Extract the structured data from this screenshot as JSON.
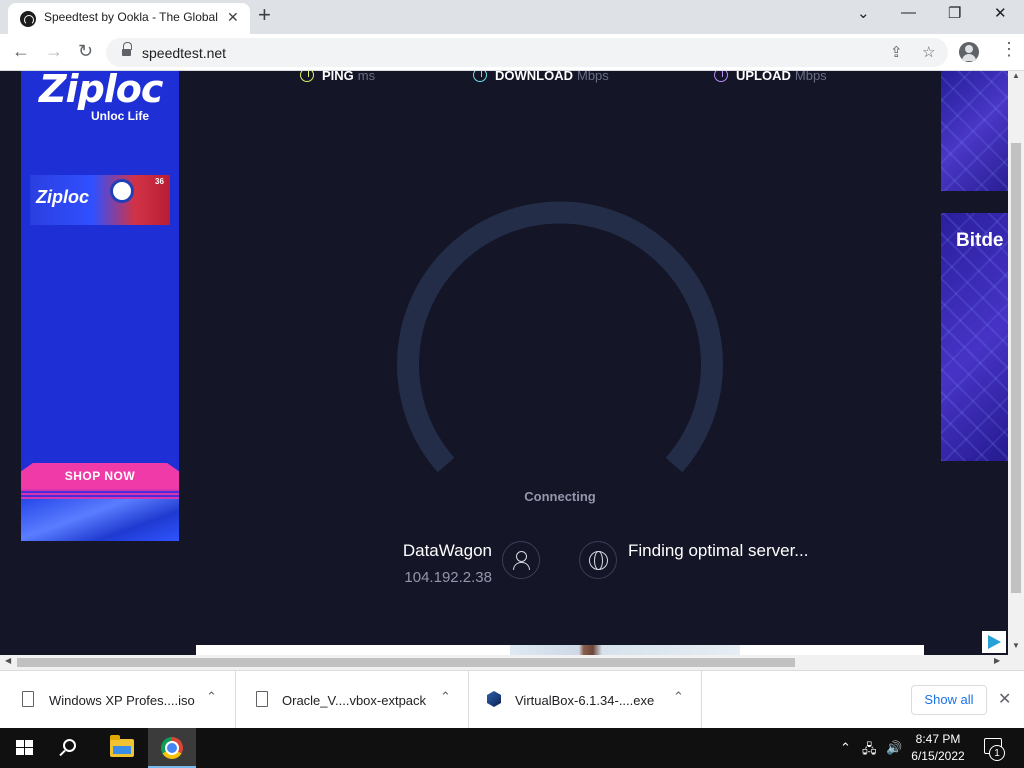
{
  "browser": {
    "tab_title": "Speedtest by Ookla - The Global Broadband Speed Test",
    "tab_close": "✕",
    "new_tab": "+",
    "url": "speedtest.net",
    "window": {
      "minimize": "—",
      "maximize": "❐",
      "close": "✕",
      "tab_search": "⌄"
    },
    "nav": {
      "back": "←",
      "forward": "→",
      "reload": "↻"
    },
    "icons": {
      "share": "⇪",
      "bookmark": "☆",
      "menu": "⋮"
    }
  },
  "page": {
    "ad_left": {
      "brand": "Ziploc",
      "tagline": "Unloc Life",
      "pack_brand": "Ziploc",
      "pack_count": "36",
      "cta": "SHOP NOW"
    },
    "ad_right": {
      "word": "Bitde"
    },
    "metrics": {
      "ping_label": "PING",
      "ping_unit": "ms",
      "download_label": "DOWNLOAD",
      "download_unit": "Mbps",
      "upload_label": "UPLOAD",
      "upload_unit": "Mbps"
    },
    "status": "Connecting",
    "isp": {
      "name": "DataWagon",
      "ip": "104.192.2.38"
    },
    "server_status": "Finding optimal server..."
  },
  "downloads": [
    {
      "name": "Windows XP Profes....iso",
      "icon": "file-icon"
    },
    {
      "name": "Oracle_V....vbox-extpack",
      "icon": "file-icon"
    },
    {
      "name": "VirtualBox-6.1.34-....exe",
      "icon": "virtualbox-icon"
    }
  ],
  "downloads_caret": "⌃",
  "show_all": "Show all",
  "shelf_close": "✕",
  "taskbar": {
    "time": "8:47 PM",
    "date": "6/15/2022",
    "notifications": "1",
    "tray": {
      "chevron": "⌃",
      "network": "🖧",
      "volume": "🔊"
    }
  },
  "colors": {
    "page_bg": "#141526",
    "gauge_track": "#2a3550",
    "accent_link": "#1a73e8",
    "ad_blue": "#1f2fd6",
    "ad_pink": "#f03aa8"
  }
}
